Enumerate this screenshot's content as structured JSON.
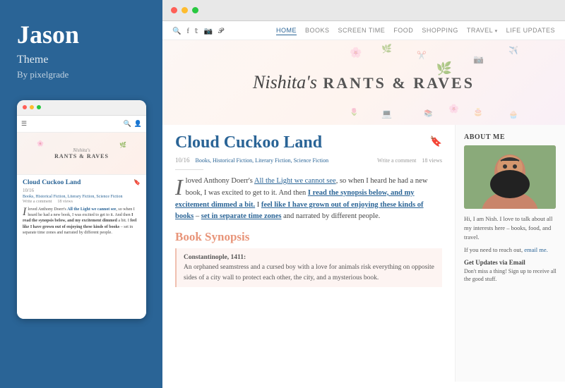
{
  "sidebar": {
    "title": "Jason",
    "subtitle": "Theme",
    "credit": "By pixelgrade"
  },
  "mobile_preview": {
    "blog_name": "Nishita's RANTS & RAVES",
    "post_title": "Cloud Cuckoo Land",
    "post_date": "10/16",
    "post_tags": "Books, Historical Fiction, Literary Fiction, Science Fiction",
    "post_write_comment": "Write a comment",
    "post_views": "18 views",
    "post_text": "I loved Anthony Doerr's All the Light we cannot see, so when I heard he had a new book, I was excited to get to it. And then I read the synopsis below, and my excitement dimmed a bit. I feel like I have grown out of enjoying these kinds of books – set in separate time zones and narrated by different people."
  },
  "browser": {
    "nav": {
      "home": "HOME",
      "books": "BOOKS",
      "screen_time": "SCREEN TIME",
      "food": "FOOD",
      "shopping": "SHOPPING",
      "travel": "TRAVEL",
      "life_updates": "LIFE UPDATES"
    },
    "social_icons": [
      "🔍",
      "f",
      "𝕋",
      "📷",
      "📌"
    ]
  },
  "blog": {
    "name_italic": "Nishita's",
    "name_rest": " RANTS & RAVES"
  },
  "article": {
    "title": "Cloud Cuckoo Land",
    "date": "10/16",
    "tags": "Books, Historical Fiction, Literary Fiction, Science Fiction",
    "write_comment": "Write a comment",
    "views": "18 views",
    "drop_cap": "I",
    "text_part1": "loved Anthony Doerr's ",
    "link1": "All the Light we cannot see",
    "text_part2": ", so when I heard he had a new book, I was excited to get to it. And then I read the synopsis below, and my excitement dimmed a bit. I ",
    "bold_link1": "feel like I have grown out of enjoying these kinds of books",
    "text_part3": " – ",
    "bold_link2": "set in separate time zones",
    "text_part4": " and narrated by different people.",
    "synopsis_title": "Book Synopsis",
    "quote_title": "Constantinople, 1411:",
    "quote_text": "An orphaned seamstress and a cursed boy with a love for animals risk everything on opposite sides of a city wall to protect each other, the city, and a mysterious book."
  },
  "right_sidebar": {
    "about_title": "About me",
    "about_text": "Hi, I am Nish. I love to talk about all my interests here – books, food, and travel.",
    "about_link_text": "If you need to reach out, email me.",
    "get_updates_title": "Get Updates via Email",
    "updates_text": "Don't miss a thing! Sign up to receive all the good stuff."
  }
}
